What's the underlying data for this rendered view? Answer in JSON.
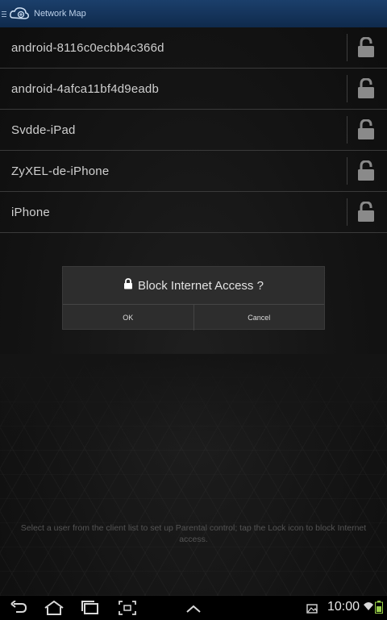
{
  "appbar": {
    "title": "Network Map",
    "icons": {
      "menu": "menu-lines-icon",
      "logo": "router-logo-icon"
    }
  },
  "clients": [
    {
      "name": "android-8116c0ecbb4c366d",
      "lock_icon": "lock-icon"
    },
    {
      "name": "android-4afca11bf4d9eadb",
      "lock_icon": "lock-icon"
    },
    {
      "name": "Svdde-iPad",
      "lock_icon": "lock-icon"
    },
    {
      "name": "ZyXEL-de-iPhone",
      "lock_icon": "lock-icon"
    },
    {
      "name": "iPhone",
      "lock_icon": "lock-icon"
    }
  ],
  "dialog": {
    "title": "Block Internet Access ?",
    "ok_label": "OK",
    "cancel_label": "Cancel"
  },
  "hint": "Select a user from the client list to set up Parental control; tap the Lock icon to block Internet access.",
  "navbar": {
    "time": "10:00",
    "icons": [
      "back-icon",
      "home-icon",
      "recent-apps-icon",
      "screenshot-icon",
      "up-chevron-icon",
      "gallery-icon",
      "wifi-icon",
      "battery-icon"
    ]
  },
  "colors": {
    "appbar": "#1b3f6b",
    "background": "#141414",
    "row_text": "#cfcfcf",
    "dialog_bg": "#2d2d2d"
  }
}
